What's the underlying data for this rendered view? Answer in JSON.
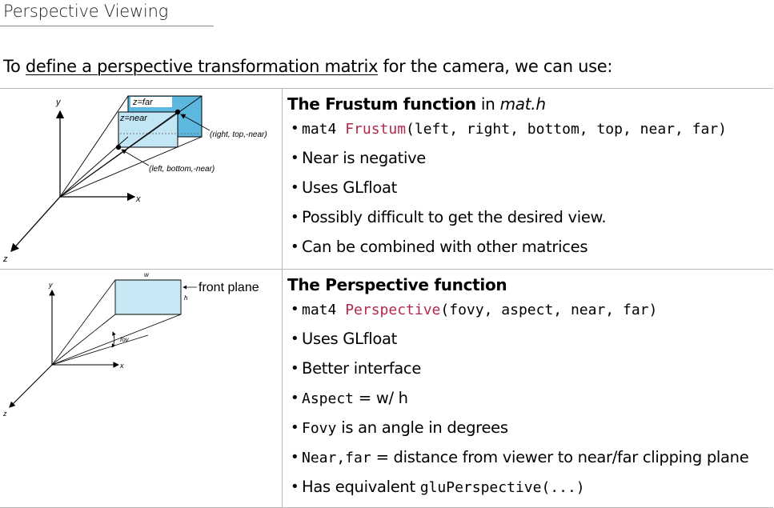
{
  "page": {
    "title": "Perspective Viewing",
    "intro": {
      "before": "To ",
      "link": "define a perspective transformation matrix",
      "after": " for the camera, we can use:"
    }
  },
  "frustum": {
    "heading_bold": "The Frustum function",
    "heading_mid": " in ",
    "heading_italic": "mat.h",
    "signature": {
      "type": "mat4 ",
      "name": "Frustum",
      "args": "(left, right, bottom, top, near, far)"
    },
    "bullets": [
      "Near is negative",
      "Uses GLfloat",
      "Possibly difficult to get the desired view.",
      "Can be combined with other matrices"
    ],
    "diagram": {
      "label_far": "z=far",
      "label_near": "z=near",
      "label_rtn": "(right, top,-near)",
      "label_lbn": "(left, bottom,-near)",
      "axis_x": "x",
      "axis_y": "y",
      "axis_z": "z",
      "colors": {
        "far_plane": "#5cb8de",
        "near_plane": "#c3e6f5",
        "label_bg": "#ffffff"
      }
    }
  },
  "perspective": {
    "heading_bold": "The Perspective function",
    "signature": {
      "type": "mat4 ",
      "name": "Perspective",
      "args": "(fovy, aspect, near, far)"
    },
    "bullets": {
      "b1": "Uses GLfloat",
      "b2": "Better interface",
      "b3_code": "Aspect",
      "b3_text": " = w/ h",
      "b4_code": "Fovy",
      "b4_text": " is an angle in degrees",
      "b5_code": "Near,far",
      "b5_text": " = distance from viewer to near/far clipping plane",
      "b6_text": "Has equivalent ",
      "b6_code": "gluPerspective(...)"
    },
    "diagram": {
      "label_front": "front plane",
      "label_w": "w",
      "label_h": "h",
      "label_fov": "fov",
      "axis_x": "x",
      "axis_y": "y",
      "axis_z": "z",
      "colors": {
        "front_plane": "#c9e8f6"
      }
    }
  }
}
